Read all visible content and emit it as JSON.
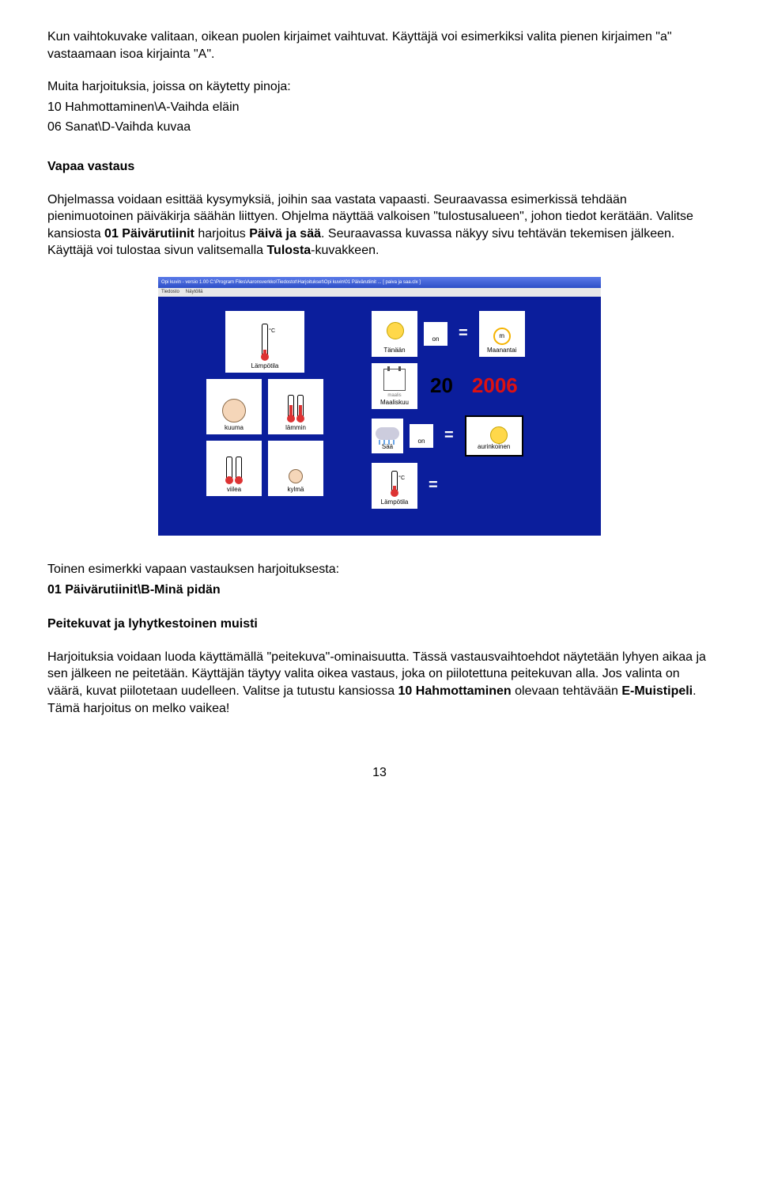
{
  "para1": "Kun vaihtokuvake valitaan, oikean puolen kirjaimet vaihtuvat. Käyttäjä voi esimerkiksi valita pienen kirjaimen \"a\" vastaamaan isoa kirjainta \"A\".",
  "para2_1": "Muita harjoituksia, joissa on käytetty pinoja:",
  "para2_2": "10 Hahmottaminen\\A-Vaihda eläin",
  "para2_3": "06 Sanat\\D-Vaihda kuvaa",
  "heading1": "Vapaa vastaus",
  "para3": {
    "t1": "Ohjelmassa voidaan esittää kysymyksiä, joihin saa vastata vapaasti. Seuraavassa esimerkissä tehdään pienimuotoinen päiväkirja säähän liittyen. Ohjelma näyttää valkoisen \"tulostusalueen\", johon tiedot kerätään. Valitse kansiosta ",
    "b1": "01 Päivärutiinit",
    "t2": " harjoitus ",
    "b2": "Päivä ja sää",
    "t3": ". Seuraavassa kuvassa näkyy sivu tehtävän tekemisen jälkeen. Käyttäjä voi tulostaa sivun valitsemalla ",
    "b3": "Tulosta",
    "t4": "-kuvakkeen."
  },
  "screenshot": {
    "titlebar": "Opi kuvin - versio 1.00   C:\\Program Files\\Aaronsverkko\\Tiedostot\\Harjoitukset\\Opi kuvin\\01 Päivärutiinit ... [    paiva ja saa.clx ]",
    "menu1": "Tiedosto",
    "menu2": "Näytöllä",
    "left_cards": {
      "c1": "Lämpötila",
      "c2": "kuuma",
      "c3": "lämmin",
      "c4": "viilea",
      "c5": "kylmä"
    },
    "right_cards": {
      "tanaan": "Tänään",
      "on": "on",
      "maanantai": "Maanantai",
      "m_badge": "m",
      "maaliskuu": "Maaliskuu",
      "kk_note": "maalis",
      "bignum": "20",
      "year": "2006",
      "saa": "Sää",
      "on2": "on",
      "aurinkoinen": "aurinkoinen",
      "lampotila": "Lämpötila"
    }
  },
  "para4_1": "Toinen esimerkki vapaan vastauksen harjoituksesta:",
  "para4_2": "01 Päivärutiinit\\B-Minä pidän",
  "heading2": "Peitekuvat ja lyhytkestoinen muisti",
  "para5": {
    "t1": "Harjoituksia voidaan luoda käyttämällä \"peitekuva\"-ominaisuutta. Tässä vastausvaihtoehdot näytetään lyhyen aikaa ja sen jälkeen ne peitetään. Käyttäjän täytyy valita oikea vastaus, joka on piilotettuna peitekuvan alla. Jos valinta on väärä, kuvat piilotetaan uudelleen. Valitse ja tutustu kansiossa ",
    "b1": "10 Hahmottaminen",
    "t2": " olevaan tehtävään ",
    "b2": "E-Muistipeli",
    "t3": ". Tämä harjoitus on melko vaikea!"
  },
  "pagenum": "13"
}
